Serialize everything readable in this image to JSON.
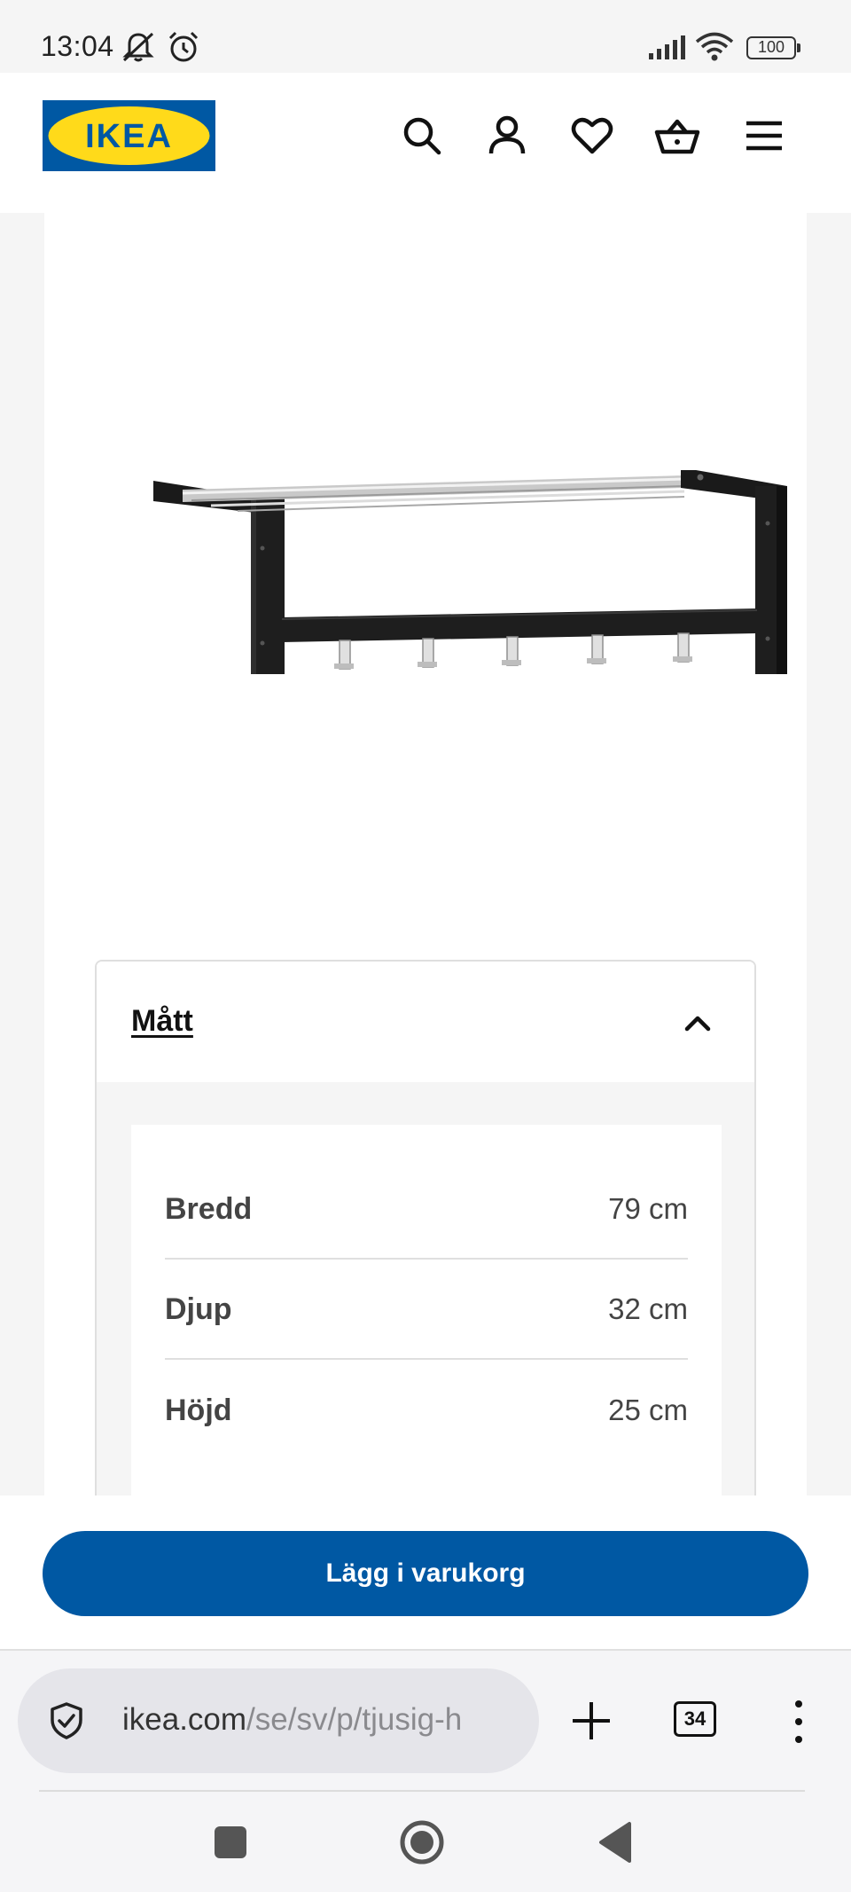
{
  "status_bar": {
    "time": "13:04",
    "battery": "100",
    "icons": [
      "mute-bell-icon",
      "alarm-icon",
      "signal-icon",
      "wifi-icon",
      "battery-icon"
    ]
  },
  "header": {
    "logo_text": "IKEA",
    "brand_colors": {
      "blue": "#0058a3",
      "yellow": "#ffda1a"
    },
    "icons": [
      "search-icon",
      "account-icon",
      "heart-icon",
      "basket-icon",
      "menu-icon"
    ]
  },
  "product": {
    "image": "wall-mounted-hat-rack-black"
  },
  "dimensions": {
    "title": "Mått",
    "toggle_icon": "chevron-up-icon",
    "rows": [
      {
        "label": "Bredd",
        "value": "79 cm"
      },
      {
        "label": "Djup",
        "value": "32 cm"
      },
      {
        "label": "Höjd",
        "value": "25 cm"
      }
    ]
  },
  "cart": {
    "button_label": "Lägg i varukorg"
  },
  "browser": {
    "url_host": "ikea.com",
    "url_path": "/se/sv/p/tjusig-h",
    "tab_count": "34",
    "icons": [
      "shield-check-icon",
      "new-tab-plus-icon",
      "tabs-icon",
      "more-vertical-icon"
    ]
  },
  "nav": {
    "icons": [
      "recents-square-icon",
      "home-circle-icon",
      "back-triangle-icon"
    ]
  }
}
